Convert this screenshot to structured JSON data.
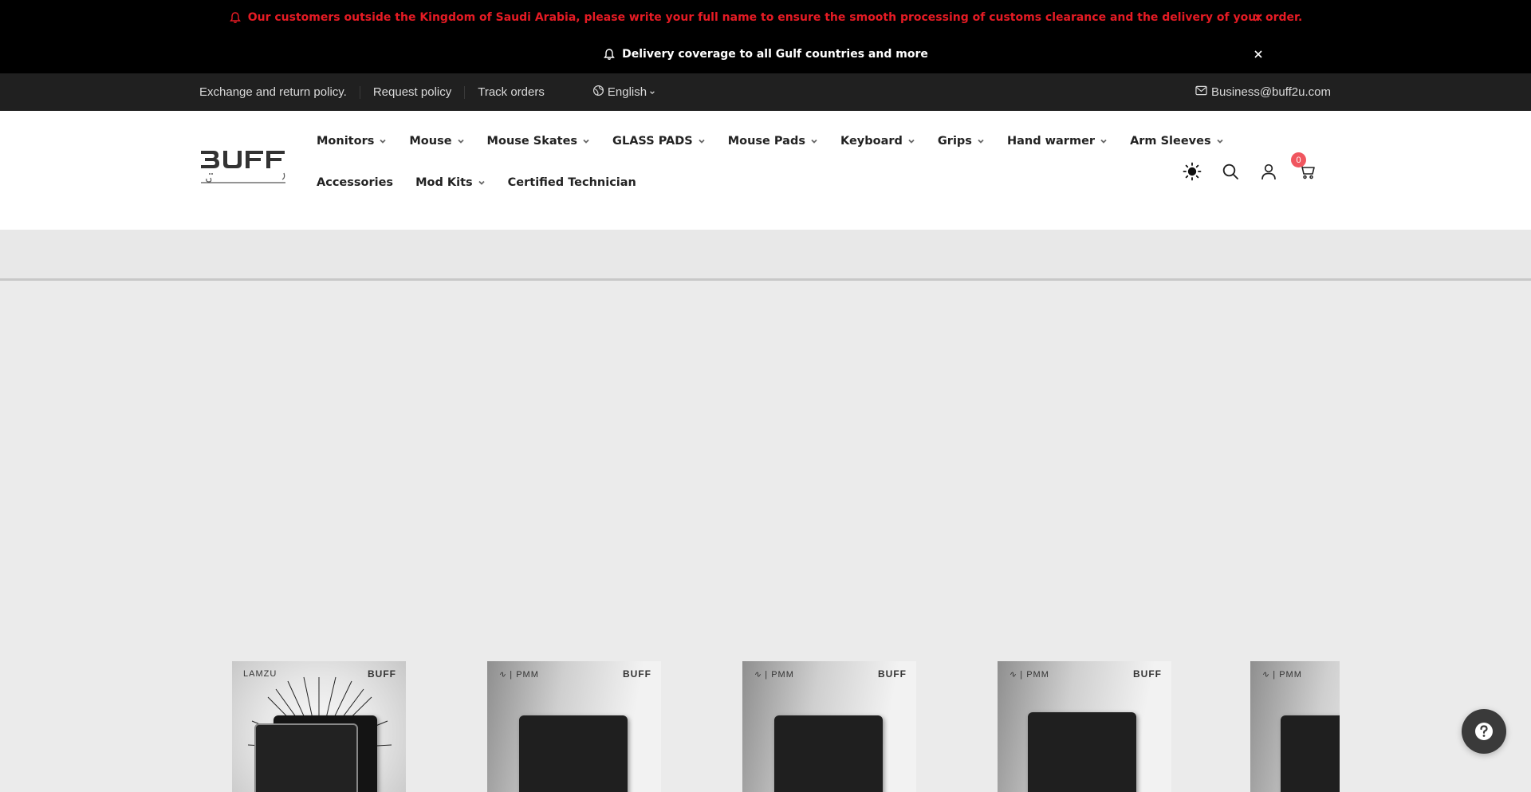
{
  "announcements": [
    {
      "text": "Our customers outside the Kingdom of Saudi Arabia, please write your full name to ensure the smooth processing of customs clearance and the delivery of your order.",
      "color": "#e51b24"
    },
    {
      "text": "Delivery coverage to all Gulf countries and more",
      "color": "#ffffff"
    }
  ],
  "topbar": {
    "links": [
      "Exchange and return policy.",
      "Request policy",
      "Track orders"
    ],
    "language": "English",
    "email": "Business@buff2u.com"
  },
  "logo": {
    "text": "BUFF"
  },
  "nav": {
    "row1": [
      {
        "label": "Monitors",
        "has_dropdown": true
      },
      {
        "label": "Mouse",
        "has_dropdown": true
      },
      {
        "label": "Mouse Skates",
        "has_dropdown": true
      },
      {
        "label": "GLASS PADS",
        "has_dropdown": true
      },
      {
        "label": "Mouse Pads",
        "has_dropdown": true
      },
      {
        "label": "Keyboard",
        "has_dropdown": true
      },
      {
        "label": "Grips",
        "has_dropdown": true
      },
      {
        "label": "Hand warmer",
        "has_dropdown": true
      },
      {
        "label": "Arm Sleeves",
        "has_dropdown": true
      }
    ],
    "row2": [
      {
        "label": "Accessories",
        "has_dropdown": false
      },
      {
        "label": "Mod Kits",
        "has_dropdown": true
      },
      {
        "label": "Certified Technician",
        "has_dropdown": false
      }
    ]
  },
  "header_icons": {
    "theme": "sun-icon",
    "search": "search-icon",
    "account": "user-icon",
    "cart": "cart-icon",
    "cart_count": "0"
  },
  "products": [
    {
      "brand_left": "LAMZU",
      "brand_right": "BUFF",
      "style": "lamzu"
    },
    {
      "brand_left": "| PMM",
      "brand_right": "BUFF",
      "style": "pmm"
    },
    {
      "brand_left": "| PMM",
      "brand_right": "BUFF",
      "style": "pmm"
    },
    {
      "brand_left": "| PMM",
      "brand_right": "BUFF",
      "style": "pmm"
    },
    {
      "brand_left": "| PMM",
      "brand_right": "",
      "style": "pmm"
    }
  ],
  "help_button": {
    "label": "?"
  },
  "colors": {
    "accent_red": "#e51b24",
    "badge": "#f0565f",
    "topbar_bg": "#202020"
  }
}
